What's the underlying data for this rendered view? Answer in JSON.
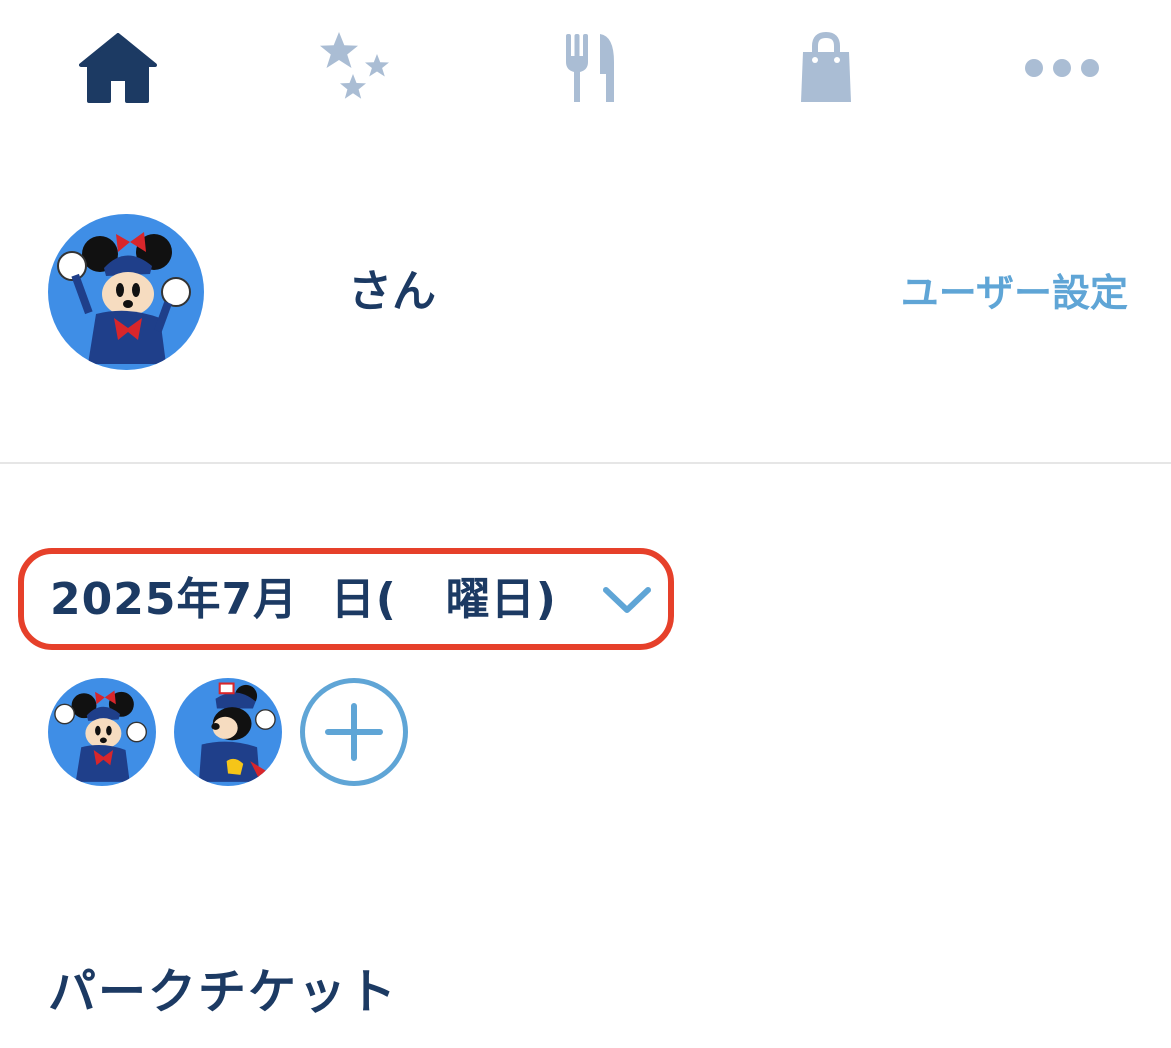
{
  "nav": {
    "items": [
      {
        "icon": "home-icon",
        "active": true
      },
      {
        "icon": "stars-icon",
        "active": false
      },
      {
        "icon": "fork-knife-icon",
        "active": false
      },
      {
        "icon": "shopping-bag-icon",
        "active": false
      },
      {
        "icon": "more-icon",
        "active": false
      }
    ]
  },
  "profile": {
    "name_suffix": "さん",
    "settings_link": "ユーザー設定"
  },
  "date_selector": {
    "label": "2025年7月  日(   曜日)"
  },
  "section": {
    "title": "パークチケット"
  },
  "colors": {
    "navy": "#1c3a63",
    "nav_inactive": "#aabdd4",
    "link_blue": "#5fa5d6",
    "highlight_red": "#e6402a",
    "avatar_bg": "#3f8ee6"
  }
}
